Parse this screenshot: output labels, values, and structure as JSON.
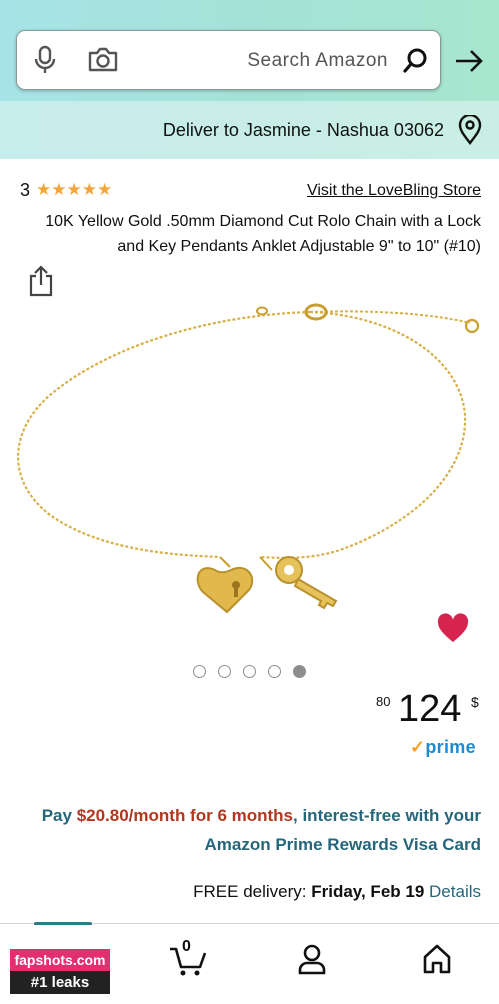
{
  "search": {
    "placeholder": "Search Amazon"
  },
  "delivery_bar": {
    "text": "Deliver to Jasmine - Nashua 03062"
  },
  "store": {
    "link": "Visit the LoveBling Store",
    "rating_count": "3",
    "stars": 5
  },
  "product": {
    "title": "10K Yellow Gold .50mm Diamond Cut Rolo Chain with a Lock and Key Pendants Anklet Adjustable 9\" to 10\" (#10)"
  },
  "carousel": {
    "count": 5,
    "active_index": 4
  },
  "price": {
    "currency": "$",
    "whole": "124",
    "cents": "80"
  },
  "prime": {
    "label": "prime"
  },
  "promo": {
    "pay": "Pay ",
    "amount": "$20.80/month for 6 months",
    "rest": ", interest-free with your Amazon Prime Rewards Visa Card"
  },
  "delivery": {
    "prefix": "FREE delivery: ",
    "day": "Friday, Feb 19",
    "details": "Details"
  },
  "bottom_nav": {
    "cart_count": "0"
  },
  "watermark": {
    "line1": "fapshots.com",
    "line2": "#1 leaks"
  },
  "colors": {
    "accent": "#26667a",
    "heart": "#d6244e",
    "star": "#f2a53a",
    "promo_amount": "#b1381f"
  }
}
